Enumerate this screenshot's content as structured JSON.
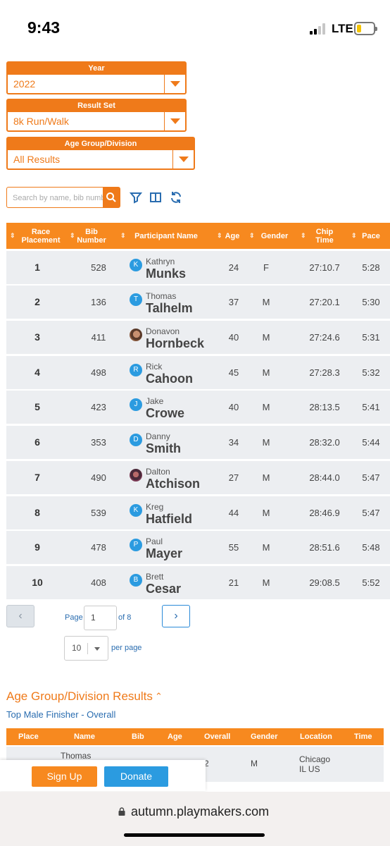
{
  "status_bar": {
    "time": "9:43",
    "network": "LTE"
  },
  "filters": {
    "year": {
      "label": "Year",
      "value": "2022"
    },
    "result_set": {
      "label": "Result Set",
      "value": "8k Run/Walk"
    },
    "age_group": {
      "label": "Age Group/Division",
      "value": "All Results"
    }
  },
  "search": {
    "placeholder": "Search by name, bib number"
  },
  "toolbar_icons": [
    "filter-icon",
    "columns-icon",
    "refresh-icon"
  ],
  "results_table": {
    "headers": [
      "Race Placement",
      "Bib Number",
      "Participant Name",
      "Age",
      "Gender",
      "Chip Time",
      "Pace"
    ],
    "rows": [
      {
        "place": "1",
        "bib": "528",
        "initial": "K",
        "first": "Kathryn",
        "last": "Munks",
        "age": "24",
        "gender": "F",
        "chip": "27:10.7",
        "pace": "5:28"
      },
      {
        "place": "2",
        "bib": "136",
        "initial": "T",
        "first": "Thomas",
        "last": "Talhelm",
        "age": "37",
        "gender": "M",
        "chip": "27:20.1",
        "pace": "5:30"
      },
      {
        "place": "3",
        "bib": "411",
        "initial": "",
        "first": "Donavon",
        "last": "Hornbeck",
        "age": "40",
        "gender": "M",
        "chip": "27:24.6",
        "pace": "5:31"
      },
      {
        "place": "4",
        "bib": "498",
        "initial": "R",
        "first": "Rick",
        "last": "Cahoon",
        "age": "45",
        "gender": "M",
        "chip": "27:28.3",
        "pace": "5:32"
      },
      {
        "place": "5",
        "bib": "423",
        "initial": "J",
        "first": "Jake",
        "last": "Crowe",
        "age": "40",
        "gender": "M",
        "chip": "28:13.5",
        "pace": "5:41"
      },
      {
        "place": "6",
        "bib": "353",
        "initial": "D",
        "first": "Danny",
        "last": "Smith",
        "age": "34",
        "gender": "M",
        "chip": "28:32.0",
        "pace": "5:44"
      },
      {
        "place": "7",
        "bib": "490",
        "initial": "",
        "first": "Dalton",
        "last": "Atchison",
        "age": "27",
        "gender": "M",
        "chip": "28:44.0",
        "pace": "5:47"
      },
      {
        "place": "8",
        "bib": "539",
        "initial": "K",
        "first": "Kreg",
        "last": "Hatfield",
        "age": "44",
        "gender": "M",
        "chip": "28:46.9",
        "pace": "5:47"
      },
      {
        "place": "9",
        "bib": "478",
        "initial": "P",
        "first": "Paul",
        "last": "Mayer",
        "age": "55",
        "gender": "M",
        "chip": "28:51.6",
        "pace": "5:48"
      },
      {
        "place": "10",
        "bib": "408",
        "initial": "B",
        "first": "Brett",
        "last": "Cesar",
        "age": "21",
        "gender": "M",
        "chip": "29:08.5",
        "pace": "5:52"
      }
    ]
  },
  "pagination": {
    "page_label": "Page",
    "page_value": "1",
    "of_label": "of 8",
    "per_page_value": "10",
    "per_page_label": "per page",
    "prev": "‹",
    "next": "›"
  },
  "age_group_results": {
    "title": "Age Group/Division Results",
    "subtitle": "Top Male Finisher - Overall",
    "headers": [
      "Place",
      "Name",
      "Bib",
      "Age",
      "Overall",
      "Gender",
      "Location",
      "Time"
    ],
    "row": {
      "name": "Thomas",
      "overall": "2",
      "gender": "M",
      "location_city": "Chicago",
      "location_region": "IL US"
    }
  },
  "actions": {
    "signup": "Sign Up",
    "donate": "Donate"
  },
  "browser": {
    "url": "autumn.playmakers.com"
  },
  "colors": {
    "accent": "#f7891f",
    "link": "#2a6db0",
    "avatar": "#2b9be0"
  }
}
